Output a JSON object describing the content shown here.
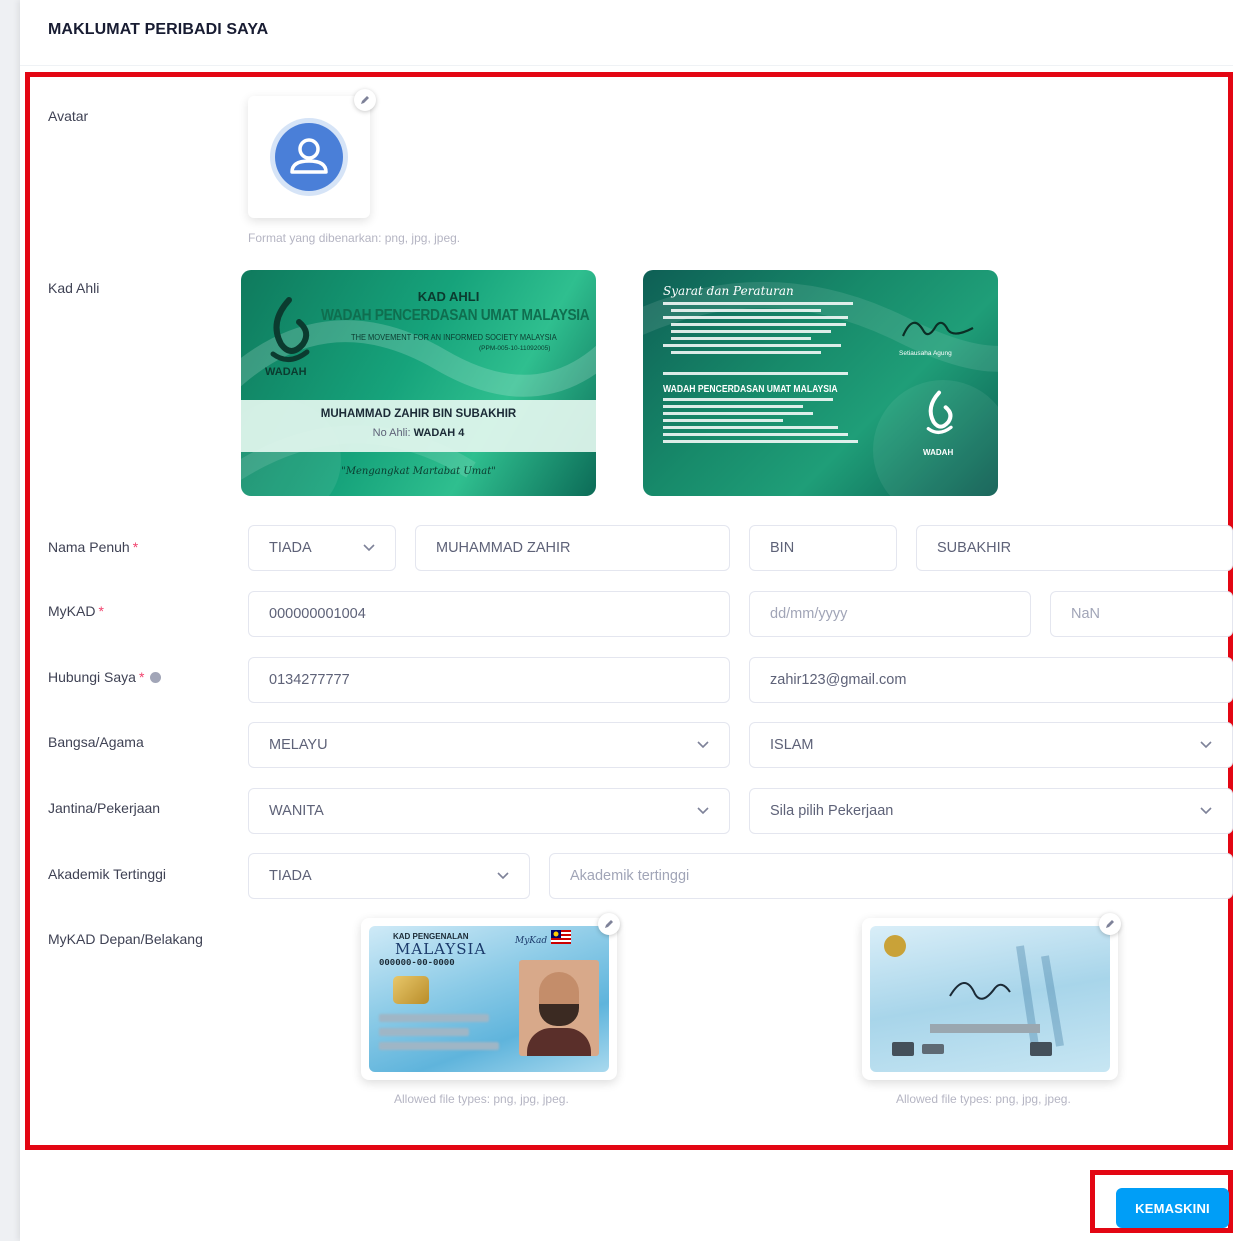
{
  "page": {
    "title": "MAKLUMAT PERIBADI SAYA"
  },
  "avatar": {
    "label": "Avatar",
    "hint": "Format yang dibenarkan: png, jpg, jpeg."
  },
  "member_card": {
    "label": "Kad Ahli",
    "front": {
      "heading": "KAD AHLI",
      "org_name": "WADAH PENCERDASAN UMAT MALAYSIA",
      "org_sub": "THE MOVEMENT FOR AN INFORMED SOCIETY MALAYSIA",
      "reg_no": "(PPM-005-10-11092005)",
      "logo_text": "WADAH",
      "member_name": "MUHAMMAD ZAHIR BIN SUBAKHIR",
      "member_no_label": "No Ahli:",
      "member_no": "WADAH 4",
      "tagline": "\"Mengangkat Martabat Umat\""
    },
    "back": {
      "heading": "Syarat dan Peraturan",
      "org_name": "WADAH PENCERDASAN UMAT MALAYSIA",
      "logo_text": "WADAH",
      "signer": "Setiausaha Agung"
    }
  },
  "form": {
    "full_name": {
      "label": "Nama Penuh",
      "title_value": "TIADA",
      "first_name": "MUHAMMAD ZAHIR",
      "bin": "BIN",
      "last_name": "SUBAKHIR"
    },
    "mykad": {
      "label": "MyKAD",
      "number": "000000001004",
      "dob_placeholder": "dd/mm/yyyy",
      "age": "NaN"
    },
    "contact": {
      "label": "Hubungi Saya",
      "phone": "0134277777",
      "email": "zahir123@gmail.com"
    },
    "race_religion": {
      "label": "Bangsa/Agama",
      "race": "MELAYU",
      "religion": "ISLAM"
    },
    "gender_job": {
      "label": "Jantina/Pekerjaan",
      "gender": "WANITA",
      "job_placeholder": "Sila pilih Pekerjaan"
    },
    "education": {
      "label": "Akademik Tertinggi",
      "level": "TIADA",
      "placeholder": "Akademik tertinggi"
    },
    "mykad_images": {
      "label": "MyKAD Depan/Belakang",
      "front_hint": "Allowed file types: png, jpg, jpeg.",
      "back_hint": "Allowed file types: png, jpg, jpeg.",
      "front_title": "KAD PENGENALAN",
      "front_country": "MALAYSIA",
      "front_number": "000000-00-0000",
      "front_brand": "MyKad"
    }
  },
  "actions": {
    "update_label": "KEMASKINI"
  },
  "colors": {
    "primary": "#009ef7",
    "highlight": "#e30613",
    "required": "#f1416c"
  }
}
